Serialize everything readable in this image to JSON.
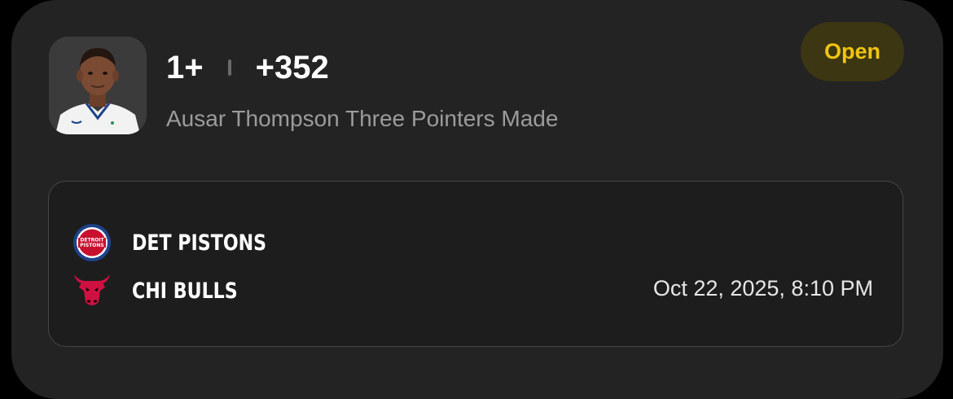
{
  "bet": {
    "line": "1+",
    "odds": "+352",
    "market": "Ausar Thompson Three Pointers Made",
    "status": "Open"
  },
  "game": {
    "teams": [
      {
        "name": "DET PISTONS",
        "logo_icon": "pistons-logo-icon"
      },
      {
        "name": "CHI BULLS",
        "logo_icon": "bulls-logo-icon"
      }
    ],
    "datetime": "Oct 22, 2025, 8:10 PM"
  },
  "colors": {
    "card_bg": "#232323",
    "badge_bg": "#3c3612",
    "badge_text": "#f1c40f",
    "pistons_red": "#c8102e",
    "pistons_blue": "#1d428a",
    "bulls_red": "#ce1141"
  }
}
